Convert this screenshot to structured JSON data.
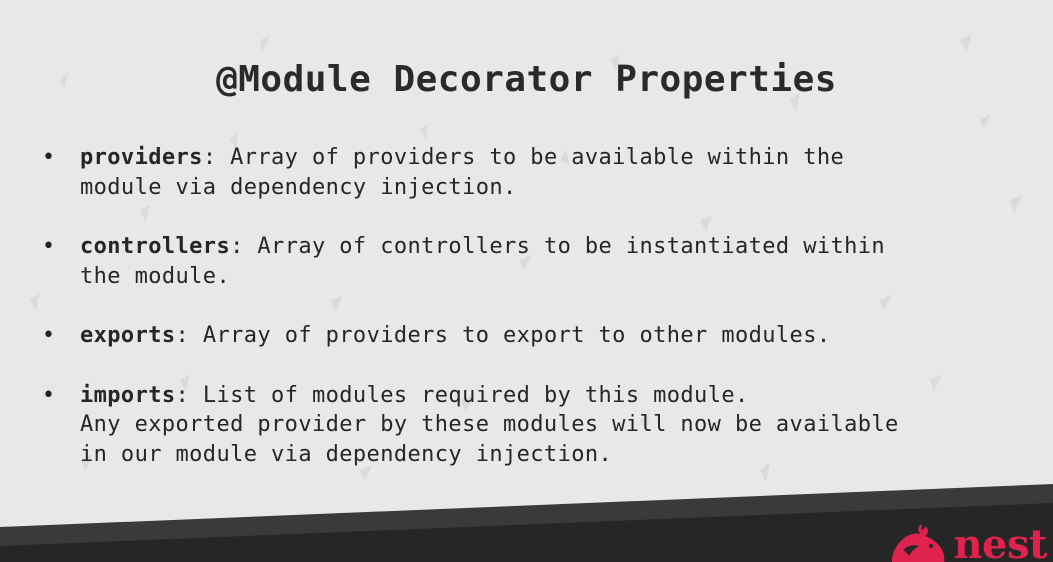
{
  "slide": {
    "title": "@Module Decorator Properties",
    "bullets": [
      {
        "term": "providers",
        "rest_first": ": Array of providers to be available within the",
        "lines": [
          "module via dependency injection."
        ]
      },
      {
        "term": "controllers",
        "rest_first": ": Array of controllers to be instantiated within",
        "lines": [
          "the module."
        ]
      },
      {
        "term": "exports",
        "rest_first": ": Array of providers to export to other modules.",
        "lines": []
      },
      {
        "term": "imports",
        "rest_first": ": List of modules required by this module.",
        "lines": [
          "Any exported provider by these modules will now be available",
          "in our module via dependency injection."
        ]
      }
    ]
  },
  "logo": {
    "text": "nest",
    "icon": "nest-cat-logo-icon"
  },
  "colors": {
    "background": "#e8e8e7",
    "footer_dark": "#262626",
    "footer_band": "#3a3a3a",
    "brand_red": "#e0234e",
    "text": "#262626"
  }
}
